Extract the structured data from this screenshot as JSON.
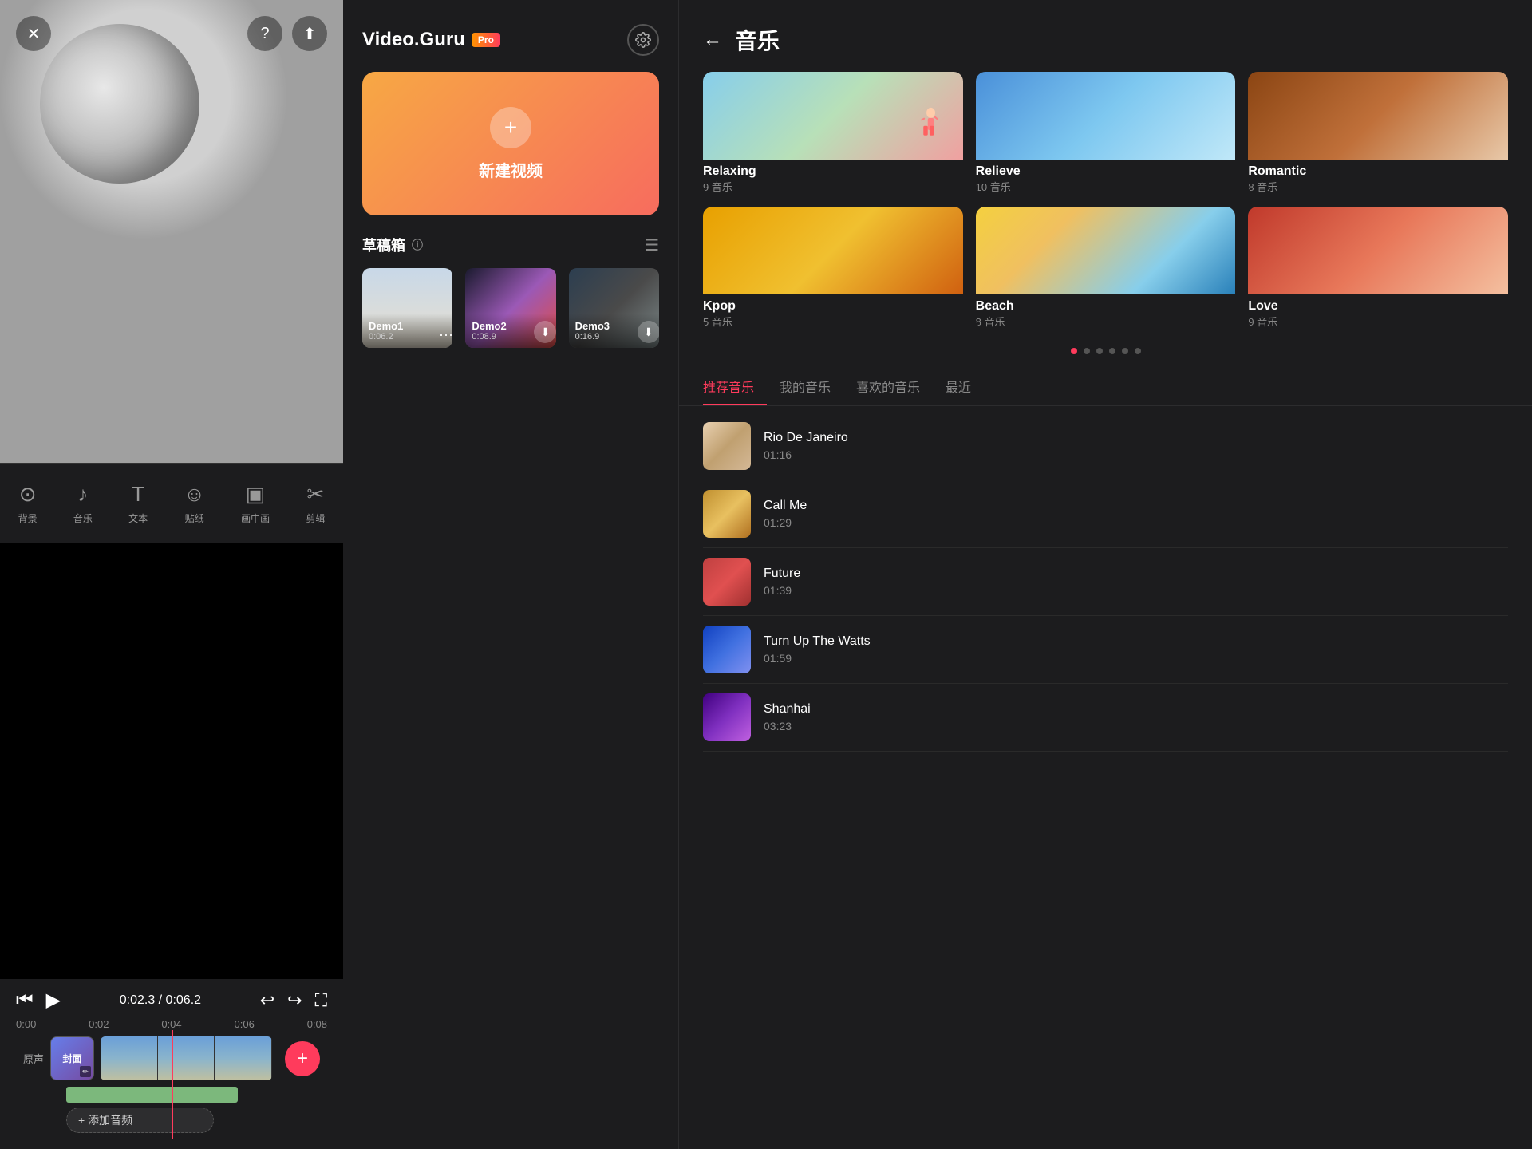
{
  "left": {
    "time_display": "0:02.3 / 0:06.2",
    "ruler_marks": [
      "0:00",
      "0:02",
      "0:04",
      "0:06",
      "0:08"
    ],
    "cover_label": "封面",
    "add_audio_label": "+ 添加音频",
    "toolbar": [
      {
        "label": "背景",
        "icon": "⊙"
      },
      {
        "label": "音乐",
        "icon": "♪"
      },
      {
        "label": "文本",
        "icon": "T"
      },
      {
        "label": "贴纸",
        "icon": "☺"
      },
      {
        "label": "画中画",
        "icon": "▣"
      },
      {
        "label": "剪辑",
        "icon": "✂"
      }
    ]
  },
  "middle": {
    "logo": "Video.Guru",
    "pro_label": "Pro",
    "new_video_label": "新建视频",
    "drafts_title": "草稿箱",
    "drafts": [
      {
        "name": "Demo1",
        "duration": "0:06.2",
        "index": 1
      },
      {
        "name": "Demo2",
        "duration": "0:08.9",
        "index": 2
      },
      {
        "name": "Demo3",
        "duration": "0:16.9",
        "index": 3
      }
    ]
  },
  "music": {
    "title": "音乐",
    "back_label": "←",
    "genres": [
      {
        "name": "Relaxing",
        "count": "9 音乐",
        "thumb": "relaxing"
      },
      {
        "name": "Relieve",
        "count": "10 音乐",
        "thumb": "relieve"
      },
      {
        "name": "Romantic",
        "count": "8 音乐",
        "thumb": "romantic"
      },
      {
        "name": "Kpop",
        "count": "5 音乐",
        "thumb": "kpop"
      },
      {
        "name": "Beach",
        "count": "8 音乐",
        "thumb": "beach"
      },
      {
        "name": "Love",
        "count": "9 音乐",
        "thumb": "love"
      }
    ],
    "tabs": [
      {
        "label": "推荐音乐",
        "active": true
      },
      {
        "label": "我的音乐",
        "active": false
      },
      {
        "label": "喜欢的音乐",
        "active": false
      },
      {
        "label": "最近",
        "active": false
      }
    ],
    "tracks": [
      {
        "name": "Rio De Janeiro",
        "duration": "01:16",
        "thumb": "rio"
      },
      {
        "name": "Call Me",
        "duration": "01:29",
        "thumb": "callme"
      },
      {
        "name": "Future",
        "duration": "01:39",
        "thumb": "future"
      },
      {
        "name": "Turn Up The Watts",
        "duration": "01:59",
        "thumb": "watts"
      },
      {
        "name": "Shanhai",
        "duration": "03:23",
        "thumb": "shanhai"
      }
    ]
  }
}
